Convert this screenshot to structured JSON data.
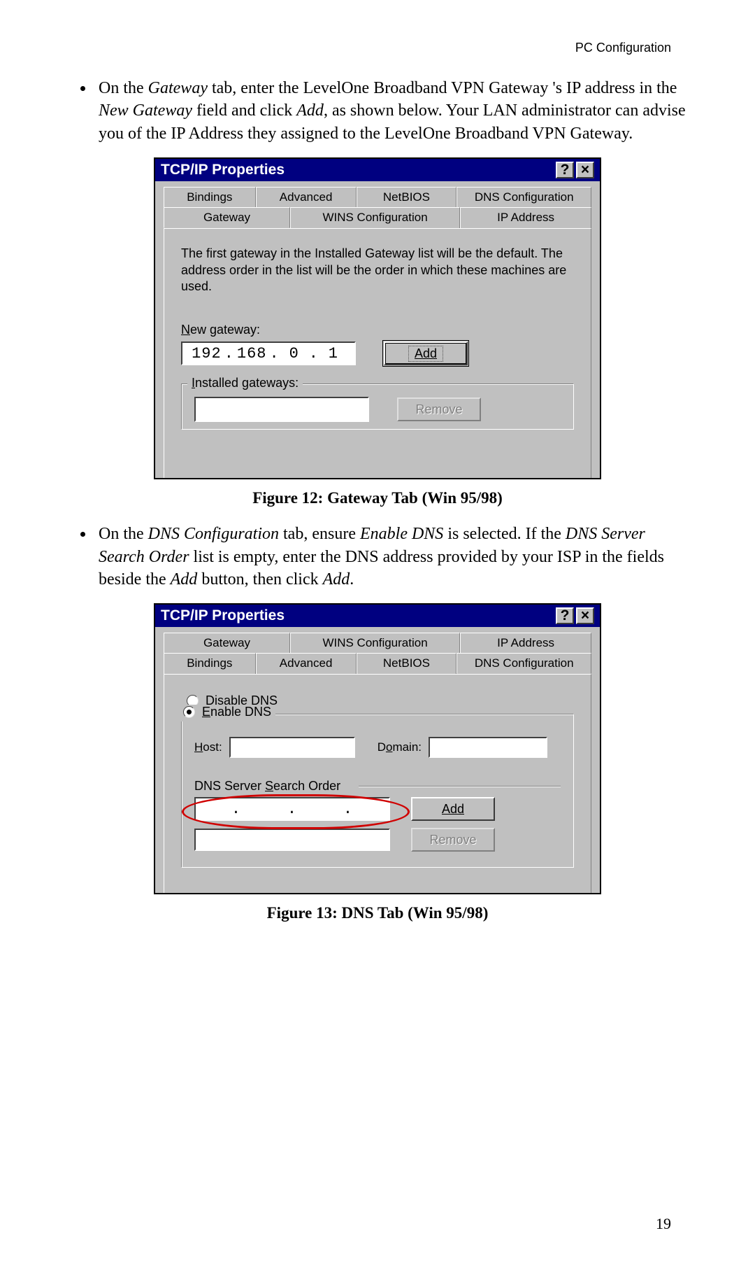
{
  "header": {
    "section": "PC Configuration"
  },
  "page_number": "19",
  "bullets": {
    "b1_pre": "On the ",
    "b1_i1": "Gateway",
    "b1_mid1": " tab, enter the LevelOne Broadband VPN Gateway 's IP address in the ",
    "b1_i2": "New Gateway",
    "b1_mid2": " field and click ",
    "b1_i3": "Add",
    "b1_post": ", as shown below. Your LAN administrator can advise you of the IP Address they assigned to the LevelOne Broadband VPN Gateway.",
    "b2_pre": "On the ",
    "b2_i1": "DNS Configuration",
    "b2_mid1": " tab, ensure ",
    "b2_i2": "Enable DNS",
    "b2_mid2": " is selected. If the ",
    "b2_i3": "DNS Server Search Order",
    "b2_mid3": " list is empty, enter the DNS address provided by your ISP in the fields beside the ",
    "b2_i4": "Add",
    "b2_mid4": " button, then click ",
    "b2_i5": "Add",
    "b2_post": "."
  },
  "captions": {
    "fig12": "Figure 12: Gateway Tab (Win 95/98)",
    "fig13": "Figure 13: DNS Tab (Win 95/98)"
  },
  "dlg1": {
    "title": "TCP/IP Properties",
    "help": "?",
    "close": "×",
    "tabs_row1": {
      "t1": "Bindings",
      "t2": "Advanced",
      "t3": "NetBIOS",
      "t4": "DNS Configuration"
    },
    "tabs_row2": {
      "t1": "Gateway",
      "t2": "WINS Configuration",
      "t3": "IP Address"
    },
    "desc": "The first gateway in the Installed Gateway list will be the default. The address order in the list will be the order in which these machines are used.",
    "new_gateway_label": "New gateway:",
    "ip": {
      "o1": "192",
      "o2": "168",
      "o3": "0",
      "o4": "1"
    },
    "add_label": "Add",
    "installed_label": "Installed gateways:",
    "remove_label": "Remove"
  },
  "dlg2": {
    "title": "TCP/IP Properties",
    "help": "?",
    "close": "×",
    "tabs_row1": {
      "t1": "Gateway",
      "t2": "WINS Configuration",
      "t3": "IP Address"
    },
    "tabs_row2": {
      "t1": "Bindings",
      "t2": "Advanced",
      "t3": "NetBIOS",
      "t4": "DNS Configuration"
    },
    "radio_disable": "Disable DNS",
    "radio_enable": "Enable DNS",
    "host_label": "Host:",
    "domain_label": "Domain:",
    "order_label": "DNS Server Search Order",
    "add_label": "Add",
    "remove_label": "Remove"
  }
}
